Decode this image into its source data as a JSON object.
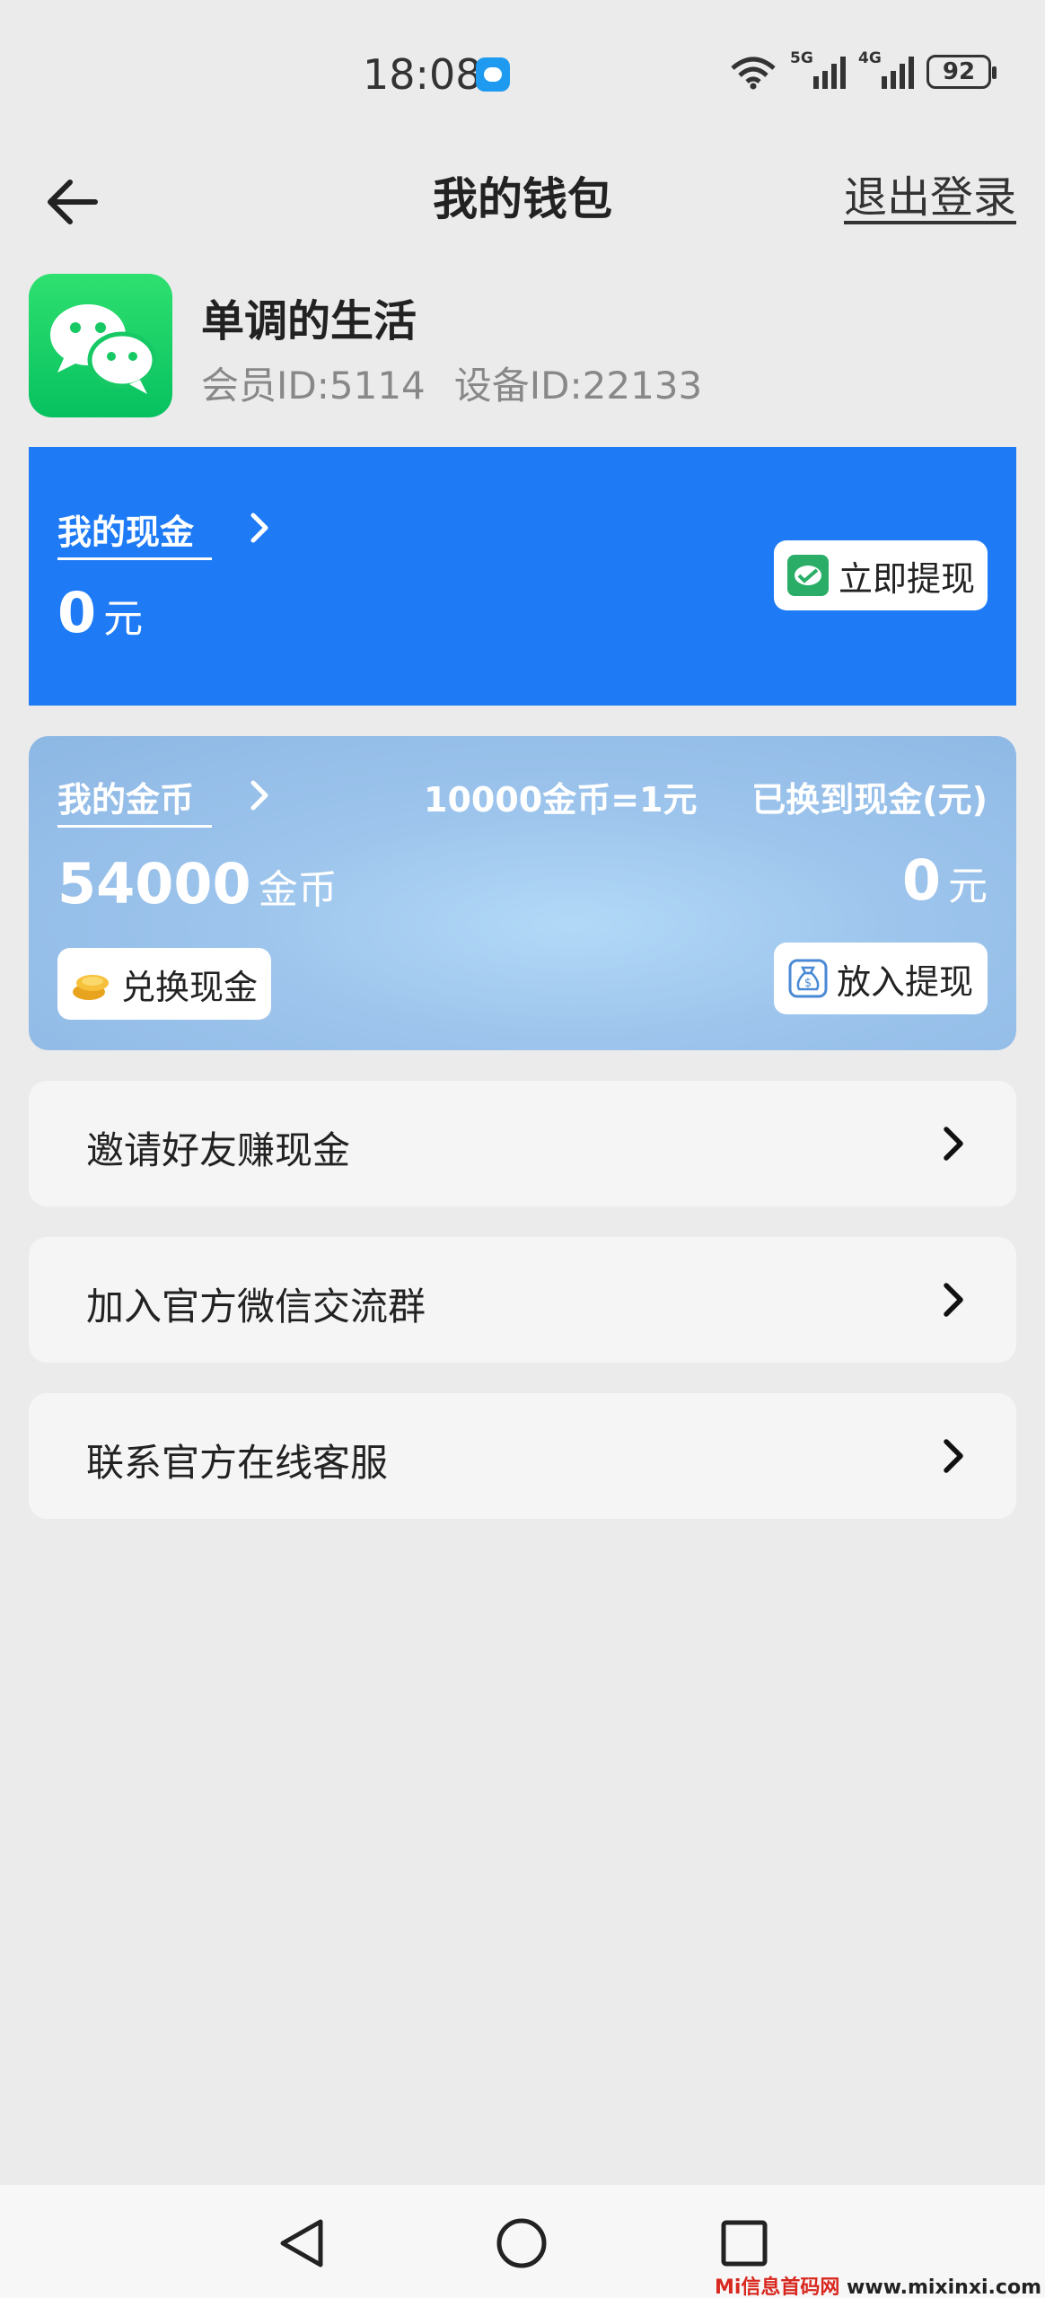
{
  "status": {
    "time": "18:08",
    "sig1_label": "5G",
    "sig2_label": "4G",
    "battery": "92"
  },
  "header": {
    "title": "我的钱包",
    "logout": "退出登录"
  },
  "profile": {
    "name": "单调的生活",
    "member_id": "会员ID:5114",
    "device_id": "设备ID:22133"
  },
  "cash": {
    "label": "我的现金",
    "amount": "0",
    "unit": "元",
    "withdraw_button": "立即提现"
  },
  "coins": {
    "label": "我的金币",
    "rate": "10000金币=1元",
    "exchanged_label": "已换到现金(元)",
    "amount": "54000",
    "unit": "金币",
    "exchanged_amount": "0",
    "exchanged_unit": "元",
    "exchange_button": "兑换现金",
    "deposit_button": "放入提现"
  },
  "menu": [
    {
      "label": "邀请好友赚现金"
    },
    {
      "label": "加入官方微信交流群"
    },
    {
      "label": "联系官方在线客服"
    }
  ],
  "watermark": {
    "brand": "Mi信息首码网",
    "url": "www.mixinxi.com"
  },
  "colors": {
    "cash_card": "#1e7bf5",
    "wechat_green": "#07c160"
  }
}
